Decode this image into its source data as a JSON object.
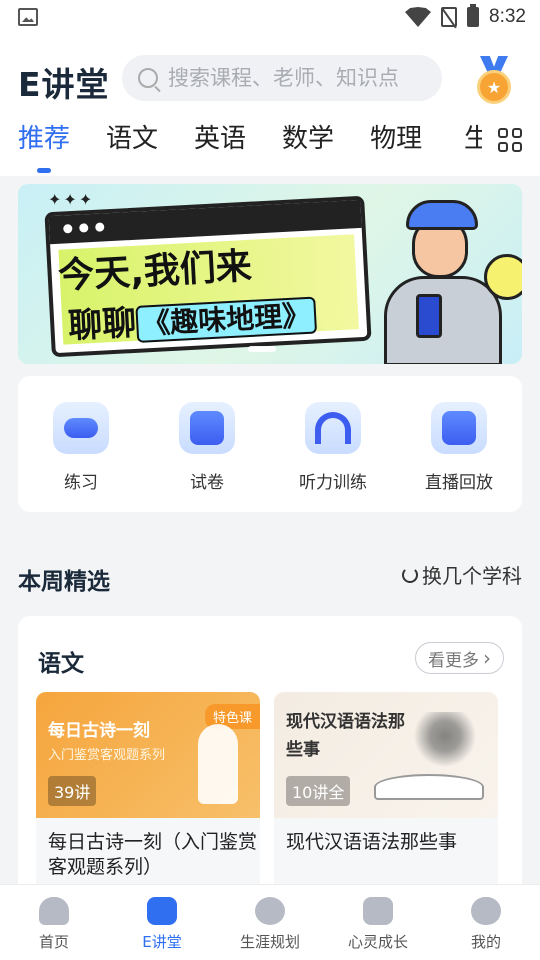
{
  "status_bar": {
    "time": "8:32"
  },
  "header": {
    "logo": "E讲堂",
    "search_placeholder": "搜索课程、老师、知识点",
    "tabs": [
      "推荐",
      "语文",
      "英语",
      "数学",
      "物理"
    ],
    "tab_clipped": "生"
  },
  "banner": {
    "line1": "今天,我们来",
    "line2_prefix": "聊聊",
    "line2_highlight": "《趣味地理》"
  },
  "entries": [
    "练习",
    "试卷",
    "听力训练",
    "直播回放"
  ],
  "weekly": {
    "title": "本周精选",
    "switch_label": "换几个学科",
    "card": {
      "subject": "语文",
      "more_label": "看更多",
      "courses": [
        {
          "cover_title": "每日古诗一刻",
          "cover_subtitle": "入门鉴赏客观题系列",
          "badge": "特色课",
          "lessons": "39讲",
          "name": "每日古诗一刻（入门鉴赏客观题系列）"
        },
        {
          "cover_title": "现代汉语语法那些事",
          "lessons": "10讲全",
          "name": "现代汉语语法那些事"
        }
      ]
    }
  },
  "bottom_nav": [
    {
      "label": "首页",
      "icon": "home-icon"
    },
    {
      "label": "E讲堂",
      "icon": "play-icon"
    },
    {
      "label": "生涯规划",
      "icon": "compass-icon"
    },
    {
      "label": "心灵成长",
      "icon": "leaf-icon"
    },
    {
      "label": "我的",
      "icon": "user-icon"
    }
  ],
  "colors": {
    "accent": "#2f6ff0",
    "badge": "#f79a2b"
  }
}
